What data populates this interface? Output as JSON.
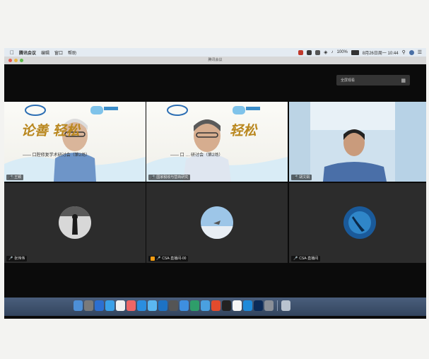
{
  "menubar": {
    "app_name": "腾讯会议",
    "items": [
      "编辑",
      "窗口",
      "帮助"
    ],
    "battery": "100%",
    "datetime": "8月26日周一 10:44"
  },
  "window": {
    "title": "腾讯会议"
  },
  "top_control": {
    "label": "全屏观看",
    "icon": "grid-icon"
  },
  "participants": [
    {
      "name": "王颖"
    },
    {
      "name": "国家税收与营商研究"
    },
    {
      "name": "胡文娟"
    },
    {
      "name": "张伟伟"
    },
    {
      "name": "CSA-直播间-00"
    },
    {
      "name": "CSA-直播间"
    }
  ],
  "banner": {
    "calligraphy": "论善 轻松",
    "subtitle_1": "—— 口腔修复学术研讨会（第2场）",
    "subtitle_2": "—— 口 … 研讨会（第2场）"
  },
  "colors": {
    "screen": "#0b0b0b",
    "tile_empty": "#2c2c2c",
    "dock": "#3f5271",
    "menubar": "#e4ebf2"
  }
}
